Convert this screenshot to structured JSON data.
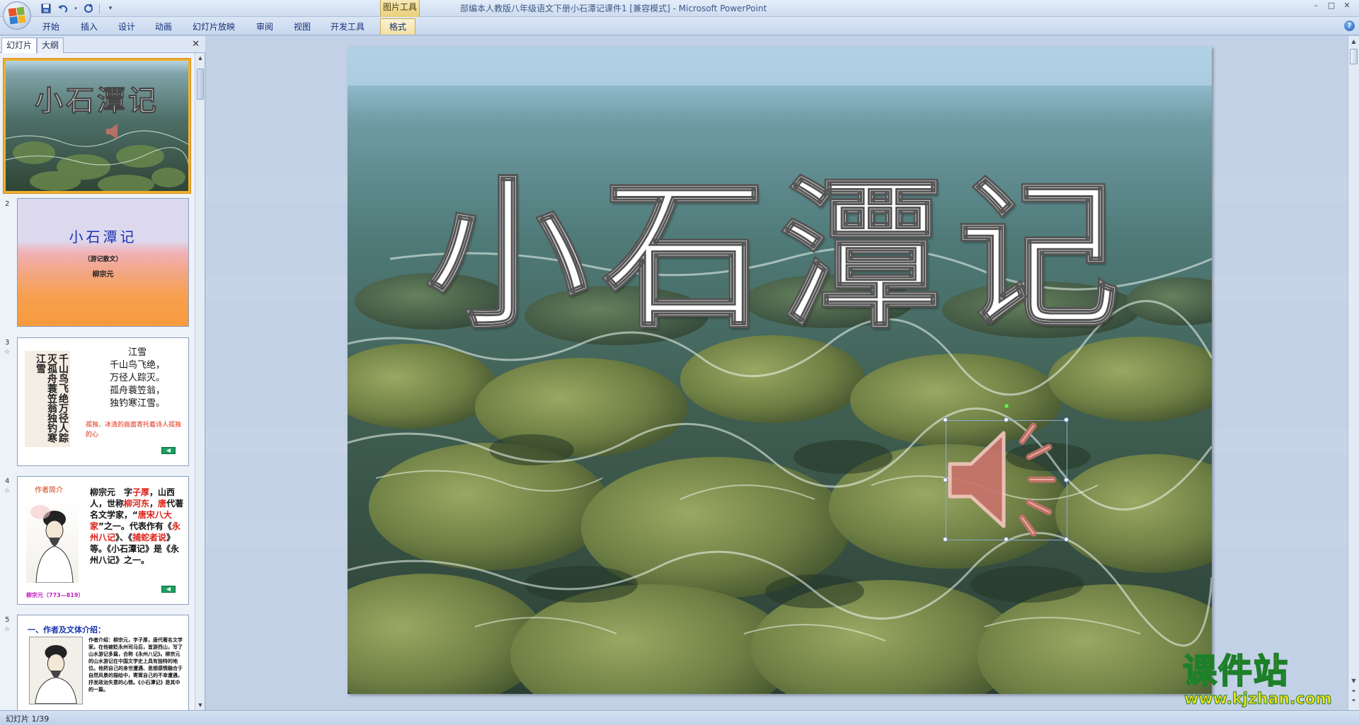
{
  "window": {
    "title": "部编本人教版八年级语文下册小石潭记课件1 [兼容模式] - Microsoft PowerPoint",
    "context_group": "图片工具",
    "controls": [
      "–",
      "□",
      "✕"
    ]
  },
  "qat": {
    "icons": [
      "save-icon",
      "undo-icon",
      "redo-icon",
      "customize-icon"
    ]
  },
  "ribbon": {
    "tabs": [
      {
        "label": "开始"
      },
      {
        "label": "插入"
      },
      {
        "label": "设计"
      },
      {
        "label": "动画"
      },
      {
        "label": "幻灯片放映"
      },
      {
        "label": "审阅"
      },
      {
        "label": "视图"
      },
      {
        "label": "开发工具"
      },
      {
        "label": "格式"
      }
    ],
    "help": "?"
  },
  "left_pane": {
    "tabs": [
      "幻灯片",
      "大纲"
    ],
    "close": "✕",
    "thumbnails": [
      {
        "number": "1",
        "title": "小石潭记"
      },
      {
        "number": "2",
        "title": "小石潭记",
        "subtitle": "（游记散文）",
        "author": "柳宗元"
      },
      {
        "number": "3",
        "poem_title": "江雪",
        "poem_lines": [
          "千山鸟飞绝，",
          "万径人踪灭。",
          "孤舟蓑笠翁，",
          "独钓寒江雪。"
        ],
        "calligraphy": "千山鸟飞绝万径人踪灭孤舟蓑笠翁独钓寒江雪",
        "note": "孤独、冰清的画面寄托着诗人孤独的心"
      },
      {
        "number": "4",
        "heading": "作者简介",
        "text_parts": [
          "柳宗元　字",
          "子厚",
          "，山西人，世称",
          "柳河东",
          "，",
          "唐",
          "代著名文学家，“",
          "唐宋八大家",
          "”之一。代表作有《",
          "永州八记",
          "》、《",
          "捕蛇者说",
          "》等。《小石潭记》是《永州八记》之一。"
        ],
        "caption": "柳宗元（773—819）"
      },
      {
        "number": "5",
        "heading": "一、作者及文体介绍：",
        "text": "作者介绍：柳宗元，字子厚，唐代著名文学家。在他被贬永州司马后，首游西山，写了山水游记多篇，合称《永州八记》。柳宗元的山水游记在中国文学史上具有独特的地位。他把自己的身世遭遇、思想感情融合于自然风景的描绘中，寄寓自己的不幸遭遇，抒发政治失意的心情。《小石潭记》是其中的一篇。"
      }
    ]
  },
  "slide": {
    "title": "小石潭记",
    "sound_icon": "speaker-icon"
  },
  "watermark": {
    "text": "课件站",
    "url": "www.kjzhan.com"
  },
  "status": {
    "slide_indicator": "幻灯片 1/39"
  }
}
